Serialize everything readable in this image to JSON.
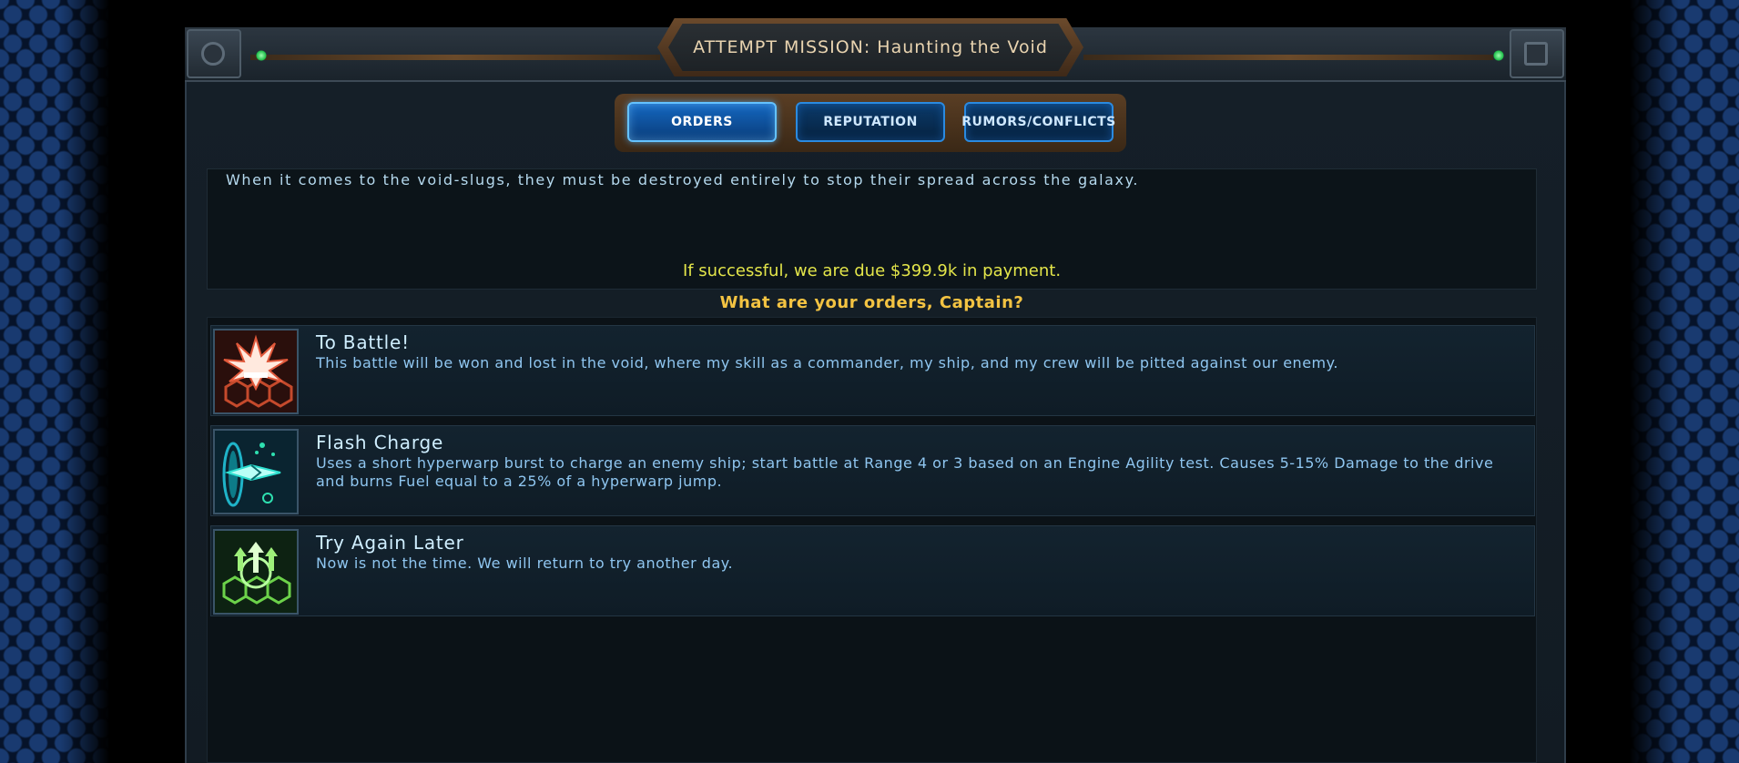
{
  "header": {
    "title": "ATTEMPT MISSION: Haunting the Void"
  },
  "tabs": [
    {
      "label": "ORDERS",
      "active": true
    },
    {
      "label": "REPUTATION",
      "active": false
    },
    {
      "label": "RUMORS/CONFLICTS",
      "active": false
    }
  ],
  "mission": {
    "description": "When it comes to the void-slugs, they must be destroyed entirely to stop their spread across the galaxy.",
    "payment": "If successful, we are due $399.9k in payment.",
    "question": "What are your orders, Captain?"
  },
  "options": [
    {
      "title": "To Battle!",
      "description": "This battle will be won and lost in the void, where my skill as a commander, my ship, and my crew will be pitted against our enemy.",
      "icon": "battle-burst-icon"
    },
    {
      "title": "Flash Charge",
      "description": "Uses a short hyperwarp burst to charge an enemy ship; start battle at Range 4 or 3 based on an Engine Agility test. Causes 5-15% Damage to the drive and burns Fuel equal to a 25% of a hyperwarp jump.",
      "icon": "warp-ship-icon"
    },
    {
      "title": "Try Again Later",
      "description": "Now is not the time. We will return to try another day.",
      "icon": "retreat-arrows-icon"
    }
  ],
  "colors": {
    "accent": "#64c2ff",
    "payment": "#e4e64a",
    "question": "#f3c342"
  }
}
